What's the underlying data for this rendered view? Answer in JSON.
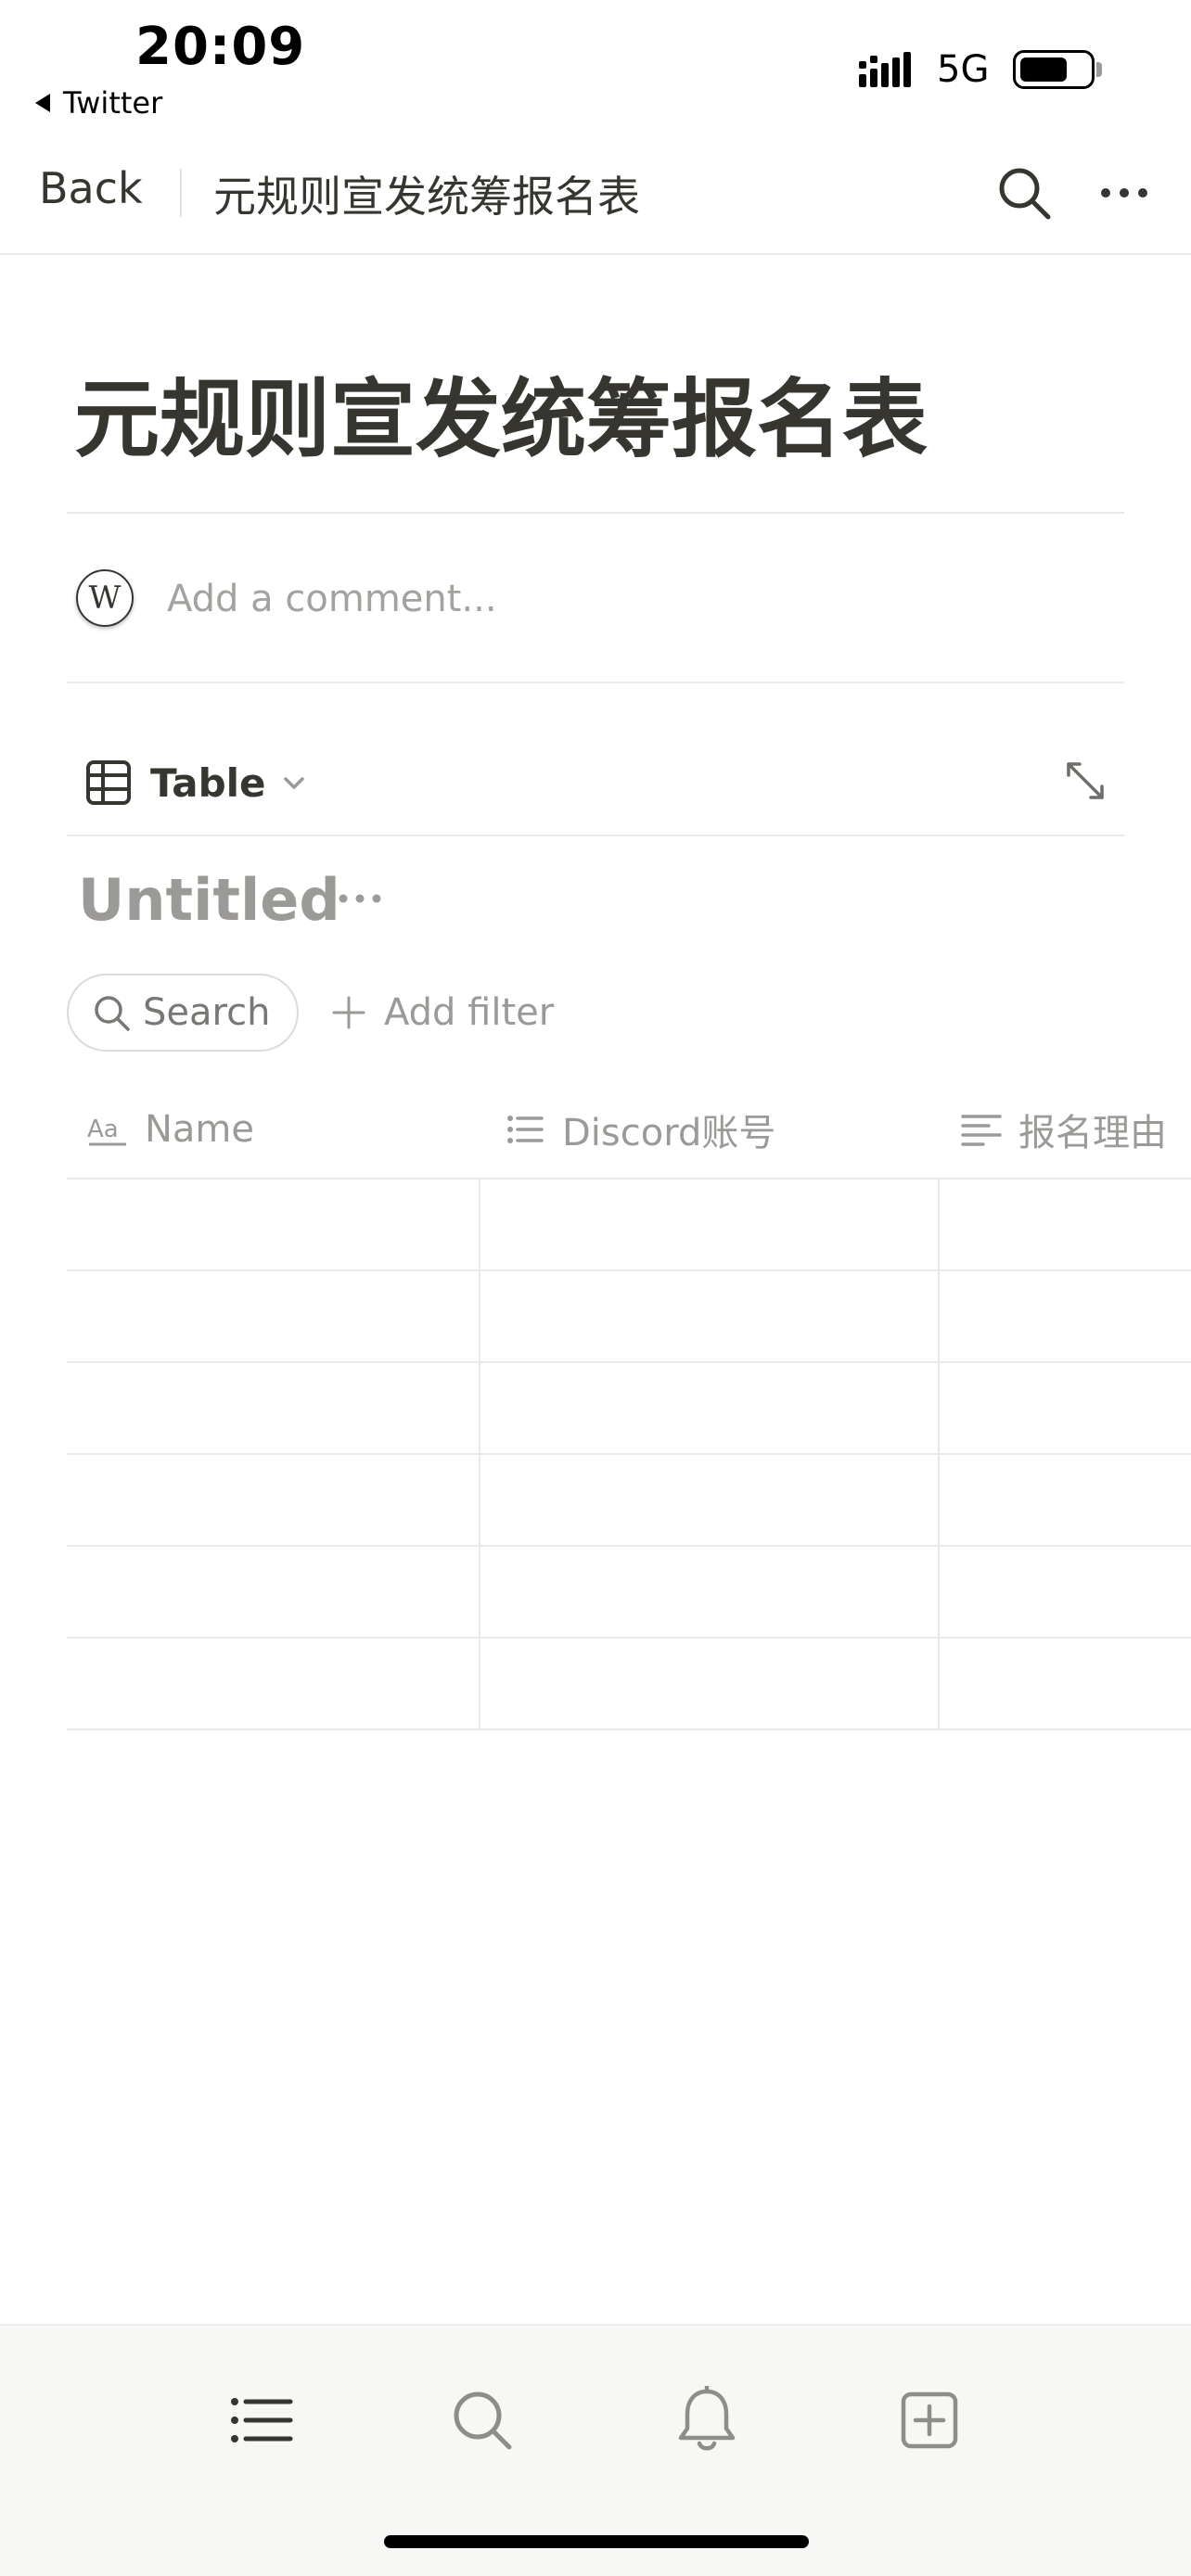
{
  "status_bar": {
    "time": "20:09",
    "back_app": "Twitter",
    "network": "5G",
    "battery_level": 0.7
  },
  "nav": {
    "back_label": "Back",
    "title": "元规则宣发统筹报名表"
  },
  "page": {
    "title": "元规则宣发统筹报名表",
    "comment": {
      "avatar_letter": "W",
      "placeholder": "Add a comment..."
    }
  },
  "database": {
    "view_label": "Table",
    "title": "Untitled",
    "search_label": "Search",
    "add_filter_label": "Add filter",
    "columns": [
      {
        "label": "Name",
        "icon": "title-property-icon"
      },
      {
        "label": "Discord账号",
        "icon": "bulleted-list-icon"
      },
      {
        "label": "报名理由",
        "icon": "text-property-icon"
      }
    ],
    "rows": [
      [
        "",
        "",
        ""
      ],
      [
        "",
        "",
        ""
      ],
      [
        "",
        "",
        ""
      ],
      [
        "",
        "",
        ""
      ],
      [
        "",
        "",
        ""
      ],
      [
        "",
        "",
        ""
      ]
    ]
  },
  "tab_bar": {
    "tabs": [
      {
        "icon": "list-icon"
      },
      {
        "icon": "search-icon"
      },
      {
        "icon": "bell-icon"
      },
      {
        "icon": "new-page-icon"
      }
    ]
  },
  "colors": {
    "text_primary": "#37352f",
    "text_muted": "#9b9a97",
    "divider": "#e9e9e7",
    "tab_bar_bg": "#f7f7f5"
  }
}
